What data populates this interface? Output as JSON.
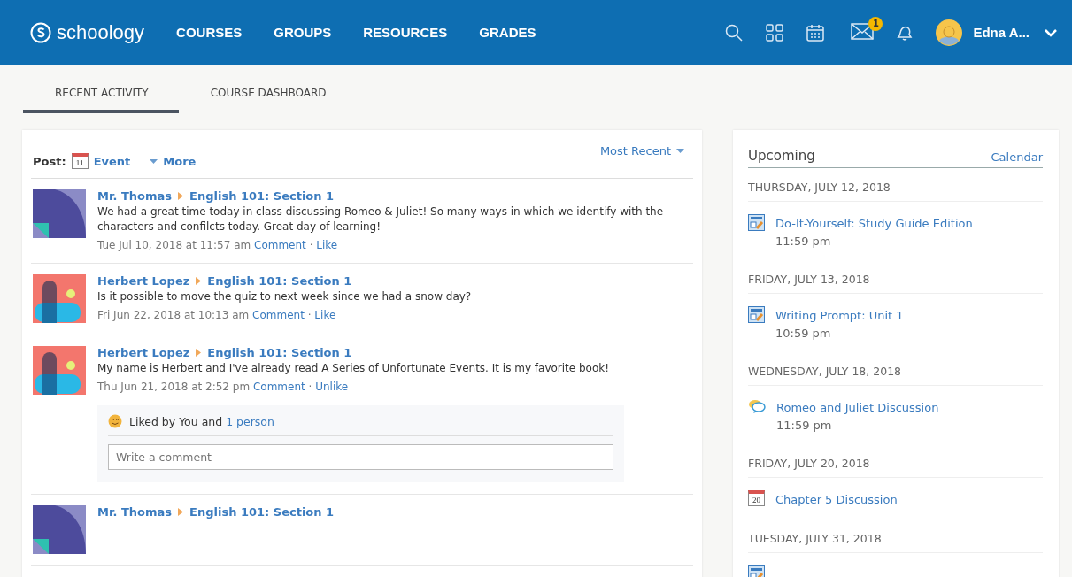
{
  "topbar": {
    "logo": "schoology",
    "nav": [
      {
        "label": "COURSES"
      },
      {
        "label": "GROUPS"
      },
      {
        "label": "RESOURCES"
      },
      {
        "label": "GRADES"
      }
    ],
    "message_badge": "1",
    "user_name": "Edna A..."
  },
  "tabs": [
    {
      "label": "RECENT ACTIVITY",
      "selected": true
    },
    {
      "label": "COURSE DASHBOARD",
      "selected": false
    }
  ],
  "feed": {
    "post_label": "Post:",
    "event_day": "11",
    "event": "Event",
    "more": "More",
    "sort": "Most Recent",
    "posts": [
      {
        "kind": "quarter",
        "author": "Mr. Thomas",
        "course": "English 101: Section 1",
        "body": "We had a great time today in class discussing Romeo & Juliet! So many ways in which we identify with the characters and confilcts today. Great day of learning!",
        "date": "Tue Jul 10, 2018 at 11:57 am",
        "actions": [
          "Comment",
          "Like"
        ],
        "separator": "·"
      },
      {
        "kind": "pill",
        "author": "Herbert Lopez",
        "course": "English 101: Section 1",
        "body": "Is it possible to move the quiz to next week since we had a snow day?",
        "date": "Fri Jun 22, 2018 at 10:13 am",
        "actions": [
          "Comment",
          "Like"
        ],
        "separator": "·"
      },
      {
        "kind": "pill",
        "author": "Herbert Lopez",
        "course": "English 101: Section 1",
        "body": "My name is Herbert and I've already read A Series of Unfortunate Events. It is my favorite book!",
        "date": "Thu Jun 21, 2018 at 2:52 pm",
        "actions": [
          "Comment",
          "Unlike"
        ],
        "separator": "·",
        "likes": {
          "text": "Liked by You and",
          "link": "1 person",
          "comment_placeholder": "Write a comment"
        }
      },
      {
        "kind": "quarter",
        "author": "Mr. Thomas",
        "course": "English 101: Section 1"
      }
    ]
  },
  "upcoming": {
    "title": "Upcoming",
    "calendar_link": "Calendar",
    "days": [
      {
        "date": "THURSDAY, JULY 12, 2018",
        "events": [
          {
            "kind": "assignment",
            "title": "Do-It-Yourself: Study Guide Edition",
            "time": "11:59 pm"
          }
        ]
      },
      {
        "date": "FRIDAY, JULY 13, 2018",
        "events": [
          {
            "kind": "assignment",
            "title": "Writing Prompt: Unit 1",
            "time": "10:59 pm"
          }
        ]
      },
      {
        "date": "WEDNESDAY, JULY 18, 2018",
        "events": [
          {
            "kind": "discussion",
            "title": "Romeo and Juliet Discussion",
            "time": "11:59 pm"
          }
        ]
      },
      {
        "date": "FRIDAY, JULY 20, 2018",
        "events": [
          {
            "kind": "event",
            "day": "20",
            "title": "Chapter 5 Discussion"
          }
        ]
      },
      {
        "date": "TUESDAY, JULY 31, 2018",
        "events": [
          {
            "kind": "assignment"
          }
        ]
      }
    ]
  }
}
